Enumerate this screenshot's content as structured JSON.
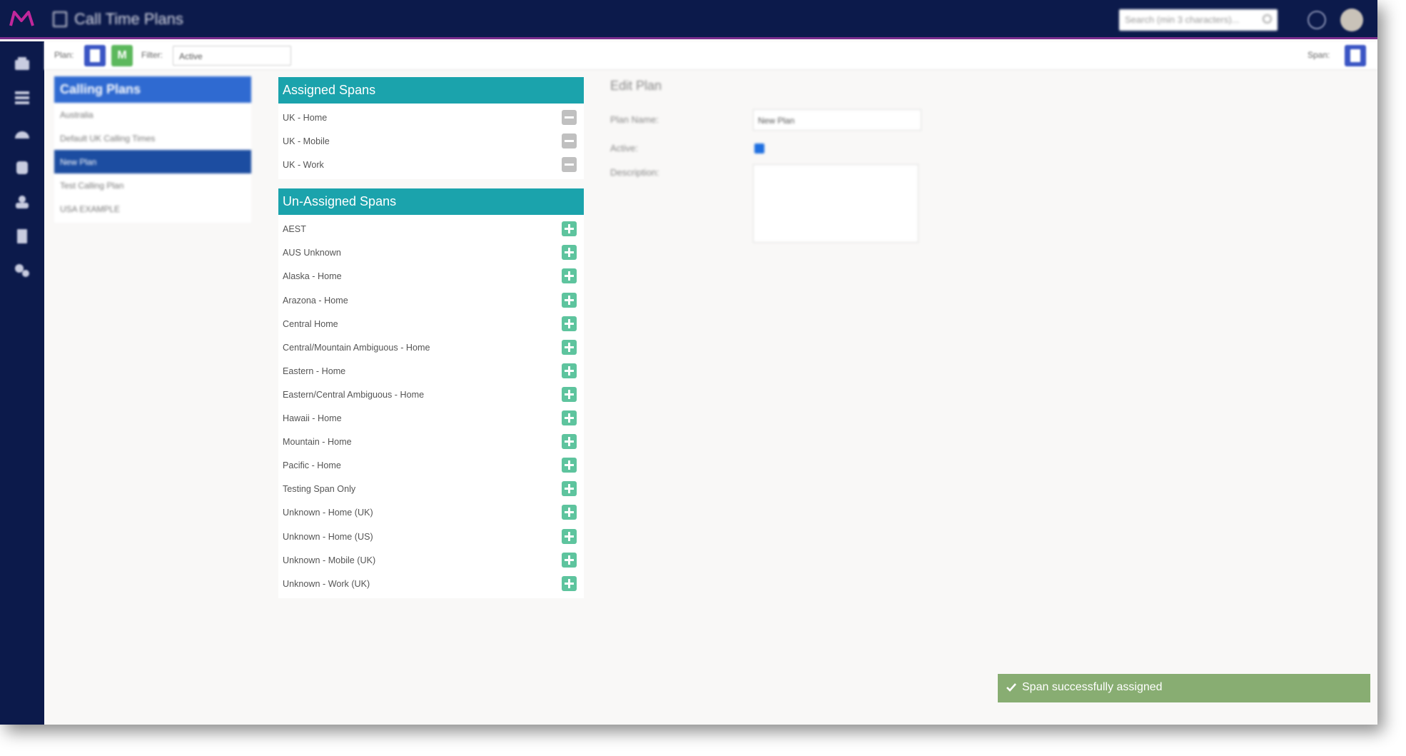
{
  "app": {
    "title": "Call Time Plans",
    "search_placeholder": "Search (min 3 characters)...",
    "brand_color": "#0c1a4b"
  },
  "sidebar": {
    "icons": [
      "dashboard-icon",
      "grid-icon",
      "gauge-icon",
      "database-icon",
      "users-icon",
      "document-icon",
      "settings-icon"
    ]
  },
  "toolbar": {
    "plan_label": "Plan:",
    "new_button_text": "M",
    "filter_label": "Filter:",
    "filter_value": "Active",
    "span_label": "Span:"
  },
  "plans": {
    "header": "Calling Plans",
    "items": [
      {
        "label": "Australia",
        "active": false
      },
      {
        "label": "Default UK Calling Times",
        "active": false
      },
      {
        "label": "New Plan",
        "active": true
      },
      {
        "label": "Test Calling Plan",
        "active": false
      },
      {
        "label": "USA EXAMPLE",
        "active": false
      }
    ]
  },
  "assigned": {
    "header": "Assigned Spans",
    "items": [
      "UK - Home",
      "UK - Mobile",
      "UK - Work"
    ]
  },
  "unassigned": {
    "header": "Un-Assigned Spans",
    "items": [
      "AEST",
      "AUS Unknown",
      "Alaska - Home",
      "Arazona - Home",
      "Central Home",
      "Central/Mountain Ambiguous - Home",
      "Eastern - Home",
      "Eastern/Central Ambiguous - Home",
      "Hawaii - Home",
      "Mountain - Home",
      "Pacific - Home",
      "Testing Span Only",
      "Unknown - Home (UK)",
      "Unknown - Home (US)",
      "Unknown - Mobile (UK)",
      "Unknown - Work (UK)"
    ]
  },
  "edit": {
    "title": "Edit Plan",
    "name_label": "Plan Name:",
    "name_value": "New Plan",
    "active_label": "Active:",
    "description_label": "Description:"
  },
  "toast": {
    "message": "Span successfully assigned",
    "color": "#88ad72"
  }
}
